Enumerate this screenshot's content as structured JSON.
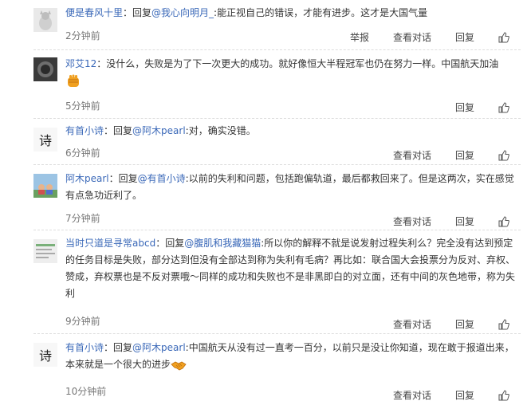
{
  "comments": [
    {
      "user": "便是春风十里",
      "reply_prefix": "：回复",
      "mention": "@我心向明月_",
      "text": ":能正视自己的错误，才能有进步。这才是大国气量",
      "time": "2分钟前",
      "actions": [
        "举报",
        "查看对话",
        "回复"
      ]
    },
    {
      "user": "邓艾12",
      "text": "：没什么，失败是为了下一次更大的成功。就好像恒大半程冠军也仍在努力一样。中国航天加油",
      "emoji": "fist-emoji",
      "time": "5分钟前",
      "actions": [
        "回复"
      ]
    },
    {
      "user": "有首小诗",
      "reply_prefix": "：回复",
      "mention": "@阿木pearl",
      "text": ":对，确实没错。",
      "time": "6分钟前",
      "actions": [
        "查看对话",
        "回复"
      ]
    },
    {
      "user": "阿木pearl",
      "reply_prefix": "：回复",
      "mention": "@有首小诗",
      "text": ":以前的失利和问题，包括跑偏轨道，最后都救回来了。但是这两次，实在感觉有点急功近利了。",
      "time": "7分钟前",
      "actions": [
        "查看对话",
        "回复"
      ]
    },
    {
      "user": "当时只道是寻常abcd",
      "reply_prefix": "：回复",
      "mention": "@腹肌和我藏猫猫",
      "text": ":所以你的解释不就是说发射过程失利么？完全没有达到预定的任务目标是失败，部分达到但没有全部达到称为失利有毛病？再比如：联合国大会投票分为反对、弃权、赞成，弃权票也是不反对票哦～同样的成功和失败也不是非黑即白的对立面，还有中间的灰色地带，称为失利",
      "time": "9分钟前",
      "actions": [
        "查看对话",
        "回复"
      ]
    },
    {
      "user": "有首小诗",
      "reply_prefix": "：回复",
      "mention": "@阿木pearl",
      "text": ":中国航天从没有过一直考一百分，以前只是没让你知道，现在敢于报道出来，本来就是一个很大的进步",
      "emoji": "handshake-emoji",
      "time": "10分钟前",
      "actions": [
        "查看对话",
        "回复"
      ]
    }
  ],
  "colors": {
    "link": "#3a68b8",
    "time": "#777777",
    "text": "#333333",
    "divider": "#dddddd"
  }
}
